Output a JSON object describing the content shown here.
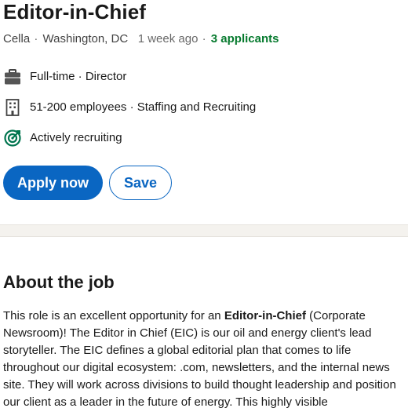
{
  "job": {
    "title": "Editor-in-Chief",
    "company": "Cella",
    "location": "Washington, DC",
    "posted": "1 week ago",
    "applicants": "3 applicants",
    "separator": "·"
  },
  "insights": [
    {
      "icon": "briefcase-icon",
      "text": "Full-time · Director"
    },
    {
      "icon": "building-icon",
      "text": "51-200 employees · Staffing and Recruiting"
    },
    {
      "icon": "target-icon",
      "text": "Actively recruiting"
    }
  ],
  "actions": {
    "apply_label": "Apply now",
    "save_label": "Save"
  },
  "about": {
    "heading": "About the job",
    "intro": "This role is an excellent opportunity for an ",
    "bold_role": "Editor-in-Chief",
    "rest": " (Corporate Newsroom)! The Editor in Chief (EIC) is our oil and energy client's lead storyteller. The EIC defines a global editorial plan that comes to life throughout our digital ecosystem: .com, newsletters, and the internal news site. They will work across divisions to build thought leadership and position our client as a leader in the future of energy. This highly visible"
  },
  "colors": {
    "brand_blue": "#0a66c2",
    "applicants_green": "#067a2e",
    "recruiting_green": "#01754f",
    "divider_band": "#f4f2ee"
  }
}
